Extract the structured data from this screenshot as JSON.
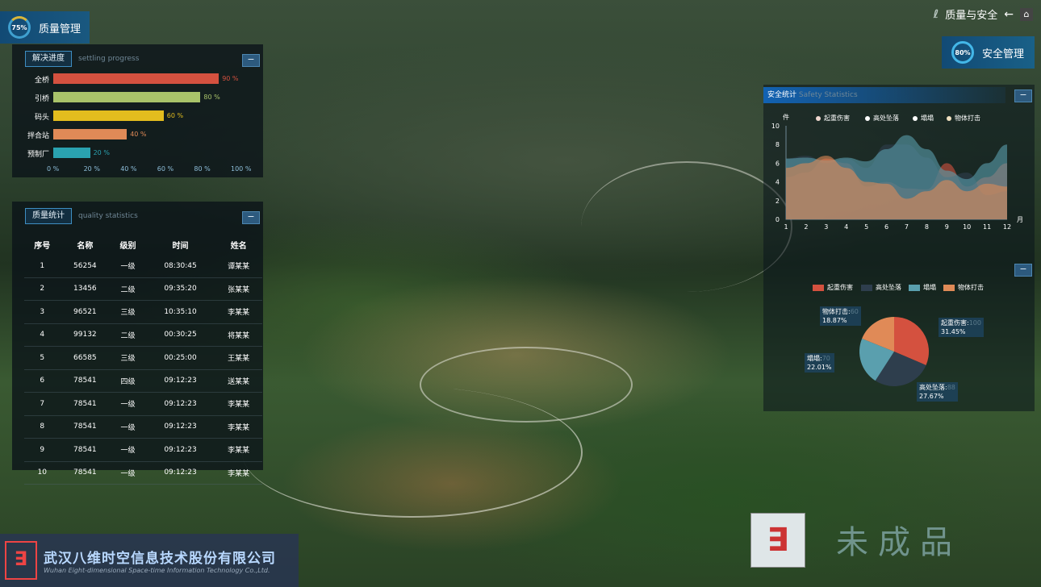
{
  "header": {
    "quality_title": "质量管理",
    "quality_percent": "75%",
    "brand": "质量与安全",
    "safety_title": "安全管理",
    "safety_percent": "80%"
  },
  "progress": {
    "title": "解决进度",
    "subtitle": "settling progress",
    "axis_ticks": [
      "0 %",
      "20 %",
      "40 %",
      "60 %",
      "80 %",
      "100 %"
    ],
    "items": [
      {
        "label": "全桥",
        "value": 90,
        "value_text": "90 %",
        "color": "#d4513f"
      },
      {
        "label": "引桥",
        "value": 80,
        "value_text": "80 %",
        "color": "#a9c36a"
      },
      {
        "label": "码头",
        "value": 60,
        "value_text": "60 %",
        "color": "#e3bd1e"
      },
      {
        "label": "拌合站",
        "value": 40,
        "value_text": "40 %",
        "color": "#e08a57"
      },
      {
        "label": "预制厂",
        "value": 20,
        "value_text": "20 %",
        "color": "#2aa2b0"
      }
    ]
  },
  "quality": {
    "title": "质量统计",
    "subtitle": "quality statistics",
    "columns": [
      "序号",
      "名称",
      "级别",
      "时间",
      "姓名"
    ],
    "rows": [
      [
        "1",
        "56254",
        "一级",
        "08:30:45",
        "谭某某"
      ],
      [
        "2",
        "13456",
        "二级",
        "09:35:20",
        "张某某"
      ],
      [
        "3",
        "96521",
        "三级",
        "10:35:10",
        "李某某"
      ],
      [
        "4",
        "99132",
        "二级",
        "00:30:25",
        "将某某"
      ],
      [
        "5",
        "66585",
        "三级",
        "00:25:00",
        "王某某"
      ],
      [
        "6",
        "78541",
        "四级",
        "09:12:23",
        "送某某"
      ],
      [
        "7",
        "78541",
        "一级",
        "09:12:23",
        "李某某"
      ],
      [
        "8",
        "78541",
        "一级",
        "09:12:23",
        "李某某"
      ],
      [
        "9",
        "78541",
        "一级",
        "09:12:23",
        "李某某"
      ],
      [
        "10",
        "78541",
        "一级",
        "09:12:23",
        "李某某"
      ]
    ]
  },
  "safety": {
    "title": "安全统计",
    "subtitle": "Safety Statistics",
    "legend": [
      {
        "name": "起重伤害",
        "color": "#d4513f"
      },
      {
        "name": "高处坠落",
        "color": "#2e3e4d"
      },
      {
        "name": "塌塌",
        "color": "#5a9fae"
      },
      {
        "name": "物体打击",
        "color": "#e08a57"
      }
    ],
    "pie_labels": [
      {
        "name": "物体打击:",
        "count": "60",
        "pct": "18.87%"
      },
      {
        "name": "起重伤害:",
        "count": "100",
        "pct": "31.45%"
      },
      {
        "name": "塌塌:",
        "count": "70",
        "pct": "22.01%"
      },
      {
        "name": "高处坠落:",
        "count": "88",
        "pct": "27.67%"
      }
    ]
  },
  "chart_data": [
    {
      "type": "bar",
      "title": "解决进度",
      "categories": [
        "全桥",
        "引桥",
        "码头",
        "拌合站",
        "预制厂"
      ],
      "values": [
        90,
        80,
        60,
        40,
        20
      ],
      "xlim": [
        0,
        100
      ],
      "orientation": "horizontal"
    },
    {
      "type": "area",
      "title": "安全统计",
      "ylabel": "件",
      "xlabel": "月",
      "x": [
        1,
        2,
        3,
        4,
        5,
        6,
        7,
        8,
        9,
        10,
        11,
        12
      ],
      "ylim": [
        0,
        10
      ],
      "yticks": [
        0,
        2,
        4,
        6,
        8,
        10
      ],
      "series": [
        {
          "name": "起重伤害",
          "color": "#d4513f",
          "values": [
            4.5,
            5,
            6.5,
            6,
            3.5,
            4,
            3.3,
            3.2,
            6,
            3.5,
            4.5,
            6
          ]
        },
        {
          "name": "高处坠落",
          "color": "#2e3e4d",
          "values": [
            6.5,
            6.8,
            6,
            6.5,
            5.5,
            8,
            8,
            6.6,
            4.5,
            5,
            2.6,
            3
          ]
        },
        {
          "name": "塌塌",
          "color": "#5a9fae",
          "values": [
            6.5,
            6.6,
            6.3,
            6.6,
            6.2,
            7.5,
            9,
            7.5,
            5.2,
            4.3,
            6,
            8
          ]
        },
        {
          "name": "物体打击",
          "color": "#e08a57",
          "values": [
            5.5,
            6,
            6.8,
            5.5,
            4,
            3.8,
            2.2,
            3,
            4.2,
            3,
            3.8,
            3.5
          ]
        }
      ]
    },
    {
      "type": "pie",
      "labels": [
        "起重伤害",
        "高处坠落",
        "塌塌",
        "物体打击"
      ],
      "values": [
        100,
        88,
        70,
        60
      ],
      "percent": [
        31.45,
        27.67,
        22.01,
        18.87
      ]
    }
  ],
  "footer": {
    "company_cn": "武汉八维时空信息技术股份有限公司",
    "company_en": "Wuhan Eight-dimensional Space-time Information Technology Co.,Ltd.",
    "watermark": "未成品"
  }
}
